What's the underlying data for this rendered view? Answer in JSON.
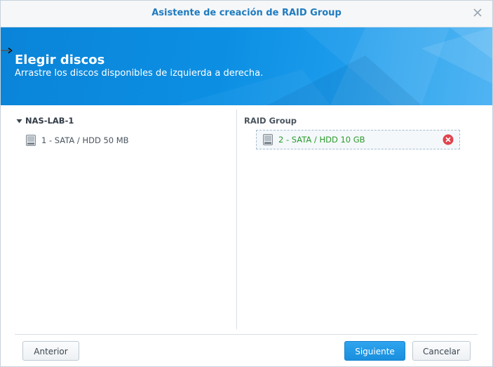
{
  "window": {
    "title": "Asistente de creación de RAID Group"
  },
  "banner": {
    "heading": "Elegir discos",
    "subheading": "Arrastre los discos disponibles de izquierda a derecha."
  },
  "left_panel": {
    "group_name": "NAS-LAB-1",
    "disks": [
      {
        "label": "1 - SATA / HDD 50 MB"
      }
    ]
  },
  "right_panel": {
    "header": "RAID Group",
    "disks": [
      {
        "label": "2 - SATA / HDD 10 GB"
      }
    ]
  },
  "footer": {
    "prev_label": "Anterior",
    "next_label": "Siguiente",
    "cancel_label": "Cancelar"
  },
  "colors": {
    "accent": "#1f7bbf",
    "banner": "#0c8fe3",
    "selected_disk_text": "#2c9b2c",
    "remove": "#e0434c",
    "primary_button": "#1a8fde"
  },
  "icons": {
    "close": "close-icon",
    "caret": "caret-down-icon",
    "disk": "hdd-icon",
    "remove": "remove-icon",
    "cursor": "resize-cursor-icon"
  }
}
